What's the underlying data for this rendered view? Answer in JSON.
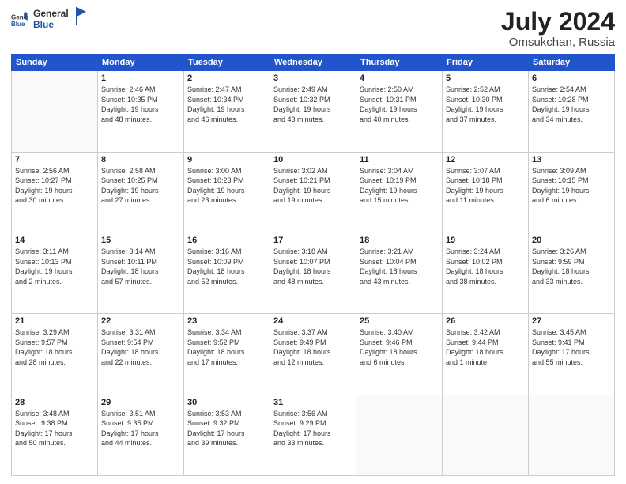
{
  "header": {
    "logo_general": "General",
    "logo_blue": "Blue",
    "month": "July 2024",
    "location": "Omsukchan, Russia"
  },
  "weekdays": [
    "Sunday",
    "Monday",
    "Tuesday",
    "Wednesday",
    "Thursday",
    "Friday",
    "Saturday"
  ],
  "weeks": [
    [
      {
        "day": "",
        "info": ""
      },
      {
        "day": "1",
        "info": "Sunrise: 2:46 AM\nSunset: 10:35 PM\nDaylight: 19 hours\nand 48 minutes."
      },
      {
        "day": "2",
        "info": "Sunrise: 2:47 AM\nSunset: 10:34 PM\nDaylight: 19 hours\nand 46 minutes."
      },
      {
        "day": "3",
        "info": "Sunrise: 2:49 AM\nSunset: 10:32 PM\nDaylight: 19 hours\nand 43 minutes."
      },
      {
        "day": "4",
        "info": "Sunrise: 2:50 AM\nSunset: 10:31 PM\nDaylight: 19 hours\nand 40 minutes."
      },
      {
        "day": "5",
        "info": "Sunrise: 2:52 AM\nSunset: 10:30 PM\nDaylight: 19 hours\nand 37 minutes."
      },
      {
        "day": "6",
        "info": "Sunrise: 2:54 AM\nSunset: 10:28 PM\nDaylight: 19 hours\nand 34 minutes."
      }
    ],
    [
      {
        "day": "7",
        "info": "Sunrise: 2:56 AM\nSunset: 10:27 PM\nDaylight: 19 hours\nand 30 minutes."
      },
      {
        "day": "8",
        "info": "Sunrise: 2:58 AM\nSunset: 10:25 PM\nDaylight: 19 hours\nand 27 minutes."
      },
      {
        "day": "9",
        "info": "Sunrise: 3:00 AM\nSunset: 10:23 PM\nDaylight: 19 hours\nand 23 minutes."
      },
      {
        "day": "10",
        "info": "Sunrise: 3:02 AM\nSunset: 10:21 PM\nDaylight: 19 hours\nand 19 minutes."
      },
      {
        "day": "11",
        "info": "Sunrise: 3:04 AM\nSunset: 10:19 PM\nDaylight: 19 hours\nand 15 minutes."
      },
      {
        "day": "12",
        "info": "Sunrise: 3:07 AM\nSunset: 10:18 PM\nDaylight: 19 hours\nand 11 minutes."
      },
      {
        "day": "13",
        "info": "Sunrise: 3:09 AM\nSunset: 10:15 PM\nDaylight: 19 hours\nand 6 minutes."
      }
    ],
    [
      {
        "day": "14",
        "info": "Sunrise: 3:11 AM\nSunset: 10:13 PM\nDaylight: 19 hours\nand 2 minutes."
      },
      {
        "day": "15",
        "info": "Sunrise: 3:14 AM\nSunset: 10:11 PM\nDaylight: 18 hours\nand 57 minutes."
      },
      {
        "day": "16",
        "info": "Sunrise: 3:16 AM\nSunset: 10:09 PM\nDaylight: 18 hours\nand 52 minutes."
      },
      {
        "day": "17",
        "info": "Sunrise: 3:18 AM\nSunset: 10:07 PM\nDaylight: 18 hours\nand 48 minutes."
      },
      {
        "day": "18",
        "info": "Sunrise: 3:21 AM\nSunset: 10:04 PM\nDaylight: 18 hours\nand 43 minutes."
      },
      {
        "day": "19",
        "info": "Sunrise: 3:24 AM\nSunset: 10:02 PM\nDaylight: 18 hours\nand 38 minutes."
      },
      {
        "day": "20",
        "info": "Sunrise: 3:26 AM\nSunset: 9:59 PM\nDaylight: 18 hours\nand 33 minutes."
      }
    ],
    [
      {
        "day": "21",
        "info": "Sunrise: 3:29 AM\nSunset: 9:57 PM\nDaylight: 18 hours\nand 28 minutes."
      },
      {
        "day": "22",
        "info": "Sunrise: 3:31 AM\nSunset: 9:54 PM\nDaylight: 18 hours\nand 22 minutes."
      },
      {
        "day": "23",
        "info": "Sunrise: 3:34 AM\nSunset: 9:52 PM\nDaylight: 18 hours\nand 17 minutes."
      },
      {
        "day": "24",
        "info": "Sunrise: 3:37 AM\nSunset: 9:49 PM\nDaylight: 18 hours\nand 12 minutes."
      },
      {
        "day": "25",
        "info": "Sunrise: 3:40 AM\nSunset: 9:46 PM\nDaylight: 18 hours\nand 6 minutes."
      },
      {
        "day": "26",
        "info": "Sunrise: 3:42 AM\nSunset: 9:44 PM\nDaylight: 18 hours\nand 1 minute."
      },
      {
        "day": "27",
        "info": "Sunrise: 3:45 AM\nSunset: 9:41 PM\nDaylight: 17 hours\nand 55 minutes."
      }
    ],
    [
      {
        "day": "28",
        "info": "Sunrise: 3:48 AM\nSunset: 9:38 PM\nDaylight: 17 hours\nand 50 minutes."
      },
      {
        "day": "29",
        "info": "Sunrise: 3:51 AM\nSunset: 9:35 PM\nDaylight: 17 hours\nand 44 minutes."
      },
      {
        "day": "30",
        "info": "Sunrise: 3:53 AM\nSunset: 9:32 PM\nDaylight: 17 hours\nand 39 minutes."
      },
      {
        "day": "31",
        "info": "Sunrise: 3:56 AM\nSunset: 9:29 PM\nDaylight: 17 hours\nand 33 minutes."
      },
      {
        "day": "",
        "info": ""
      },
      {
        "day": "",
        "info": ""
      },
      {
        "day": "",
        "info": ""
      }
    ]
  ]
}
